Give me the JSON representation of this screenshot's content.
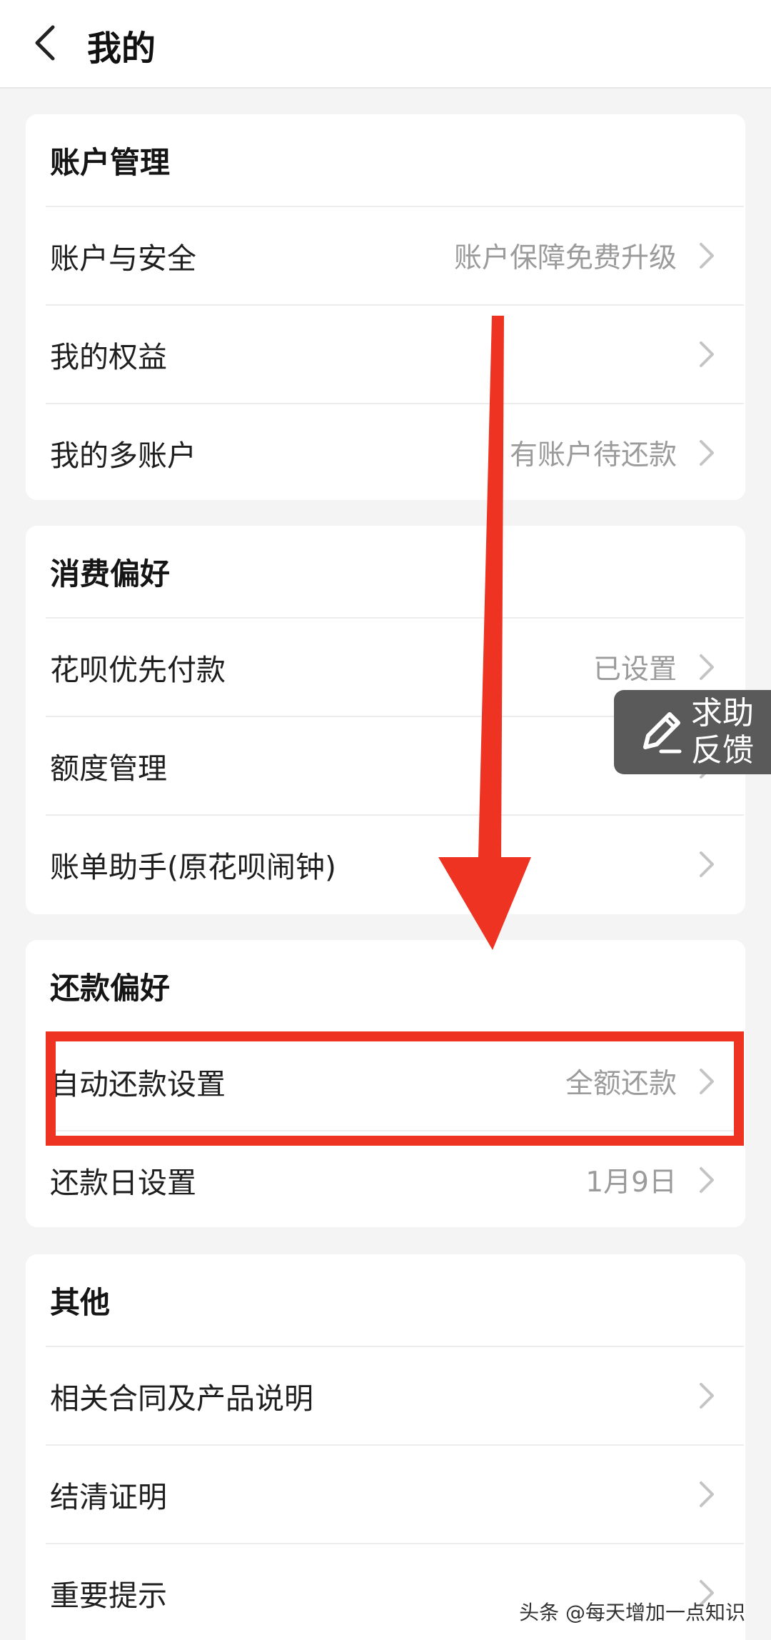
{
  "header": {
    "title": "我的",
    "back_icon": "chevron-left-icon"
  },
  "sections": [
    {
      "title": "账户管理",
      "items": [
        {
          "label": "账户与安全",
          "value": "账户保障免费升级"
        },
        {
          "label": "我的权益",
          "value": ""
        },
        {
          "label": "我的多账户",
          "value": "有账户待还款"
        }
      ]
    },
    {
      "title": "消费偏好",
      "items": [
        {
          "label": "花呗优先付款",
          "value": "已设置"
        },
        {
          "label": "额度管理",
          "value": ""
        },
        {
          "label": "账单助手(原花呗闹钟)",
          "value": ""
        }
      ]
    },
    {
      "title": "还款偏好",
      "items": [
        {
          "label": "自动还款设置",
          "value": "全额还款"
        },
        {
          "label": "还款日设置",
          "value": "1月9日"
        }
      ]
    },
    {
      "title": "其他",
      "items": [
        {
          "label": "相关合同及产品说明",
          "value": ""
        },
        {
          "label": "结清证明",
          "value": ""
        },
        {
          "label": "重要提示",
          "value": ""
        }
      ]
    }
  ],
  "help_float": {
    "label": "求助反馈",
    "icon": "pencil-icon"
  },
  "watermark": "头条 @每天增加一点知识",
  "colors": {
    "annotation_red": "#ee3322",
    "background": "#f4f4f4"
  }
}
